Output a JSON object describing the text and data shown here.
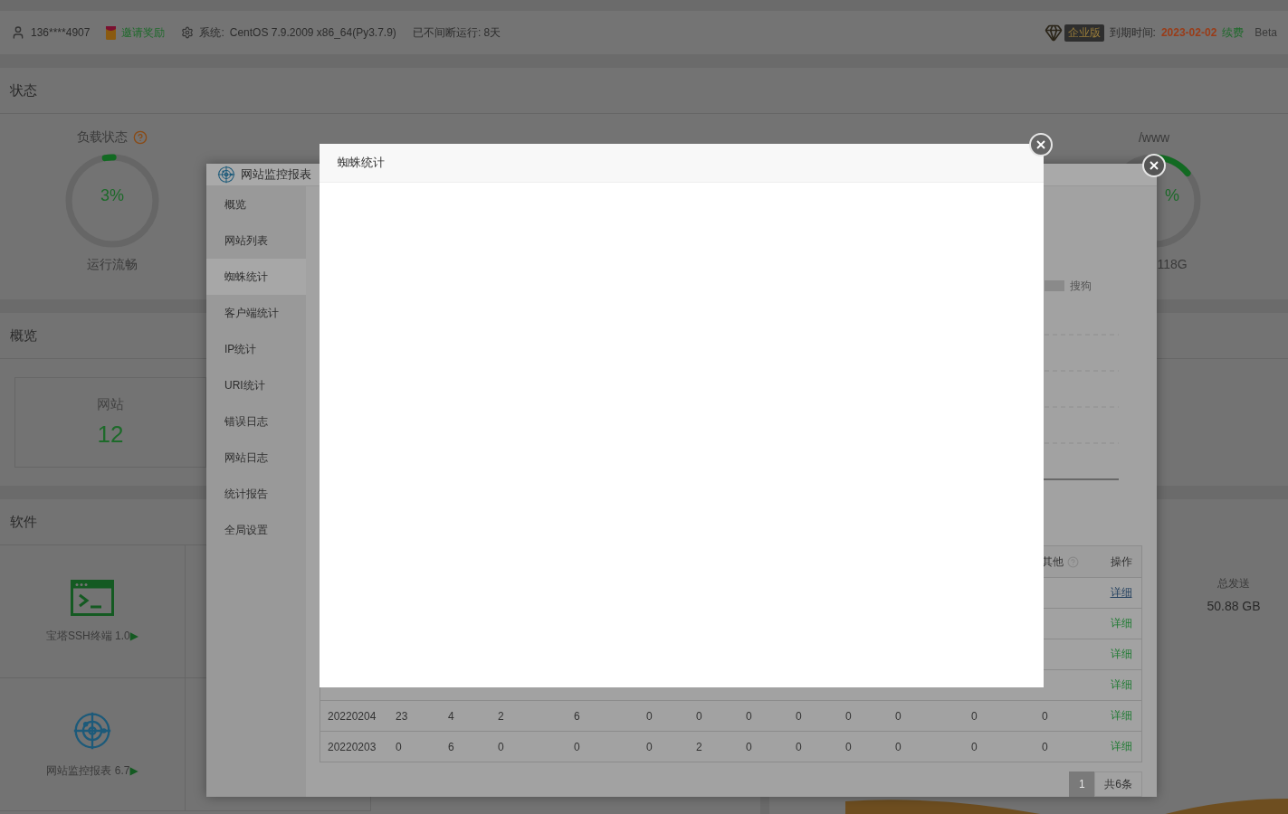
{
  "top_bar": {
    "user": "136****4907",
    "invite": "邀请奖励",
    "system_label": "系统:",
    "system": "CentOS 7.9.2009 x86_64(Py3.7.9)",
    "uptime": "已不间断运行: 8天",
    "edition": "企业版",
    "expire_label": "到期时间:",
    "expire_date": "2023-02-02",
    "renew": "续费",
    "version": "Beta"
  },
  "status": {
    "title": "状态",
    "gauges": [
      {
        "title": "负载状态",
        "help": true,
        "value": "3%",
        "caption": "运行流畅",
        "level": 0.03
      },
      {
        "title": "/www",
        "help": false,
        "value": "%",
        "caption": "118G",
        "level": 0.14
      }
    ]
  },
  "overview": {
    "title": "概览",
    "cards": [
      {
        "label": "网站",
        "value": "12"
      }
    ]
  },
  "software": {
    "title": "软件",
    "items": [
      {
        "kind": "terminal",
        "name": "宝塔SSH终端 1.0",
        "arrow": "▶"
      },
      {
        "kind": "monitor",
        "name": "网站监控报表 6.7",
        "arrow": "▶"
      }
    ]
  },
  "traffic": {
    "sent_label": "总发送",
    "sent_value": "50.88 GB"
  },
  "plugin_window": {
    "title": "网站监控报表",
    "menu": [
      {
        "label": "概览",
        "selected": false
      },
      {
        "label": "网站列表",
        "selected": false
      },
      {
        "label": "蜘蛛统计",
        "selected": true
      },
      {
        "label": "客户端统计",
        "selected": false
      },
      {
        "label": "IP统计",
        "selected": false
      },
      {
        "label": "URI统计",
        "selected": false
      },
      {
        "label": "错误日志",
        "selected": false
      },
      {
        "label": "网站日志",
        "selected": false
      },
      {
        "label": "统计报告",
        "selected": false
      },
      {
        "label": "全局设置",
        "selected": false
      }
    ],
    "legend": [
      "搜狗"
    ],
    "table": {
      "columns": [
        {
          "label": "其他",
          "help": true
        },
        {
          "label": "操作",
          "help": false
        }
      ],
      "rows": [
        {
          "action": "详细",
          "focused": true
        },
        {
          "action": "详细",
          "focused": false
        },
        {
          "action": "详细",
          "focused": false
        },
        {
          "action": "详细",
          "focused": false
        },
        {
          "cells": [
            "20220204",
            "23",
            "4",
            "2",
            "6",
            "0",
            "0",
            "0",
            "0",
            "0",
            "0",
            "0",
            "0"
          ],
          "action": "详细",
          "focused": false
        },
        {
          "cells": [
            "20220203",
            "0",
            "6",
            "0",
            "0",
            "0",
            "2",
            "0",
            "0",
            "0",
            "0",
            "0",
            "0"
          ],
          "action": "详细",
          "focused": false
        }
      ]
    },
    "pagination": {
      "pages": [
        {
          "label": "1",
          "selected": true
        }
      ],
      "total": "共6条"
    }
  },
  "dialog": {
    "title": "蜘蛛统计"
  }
}
